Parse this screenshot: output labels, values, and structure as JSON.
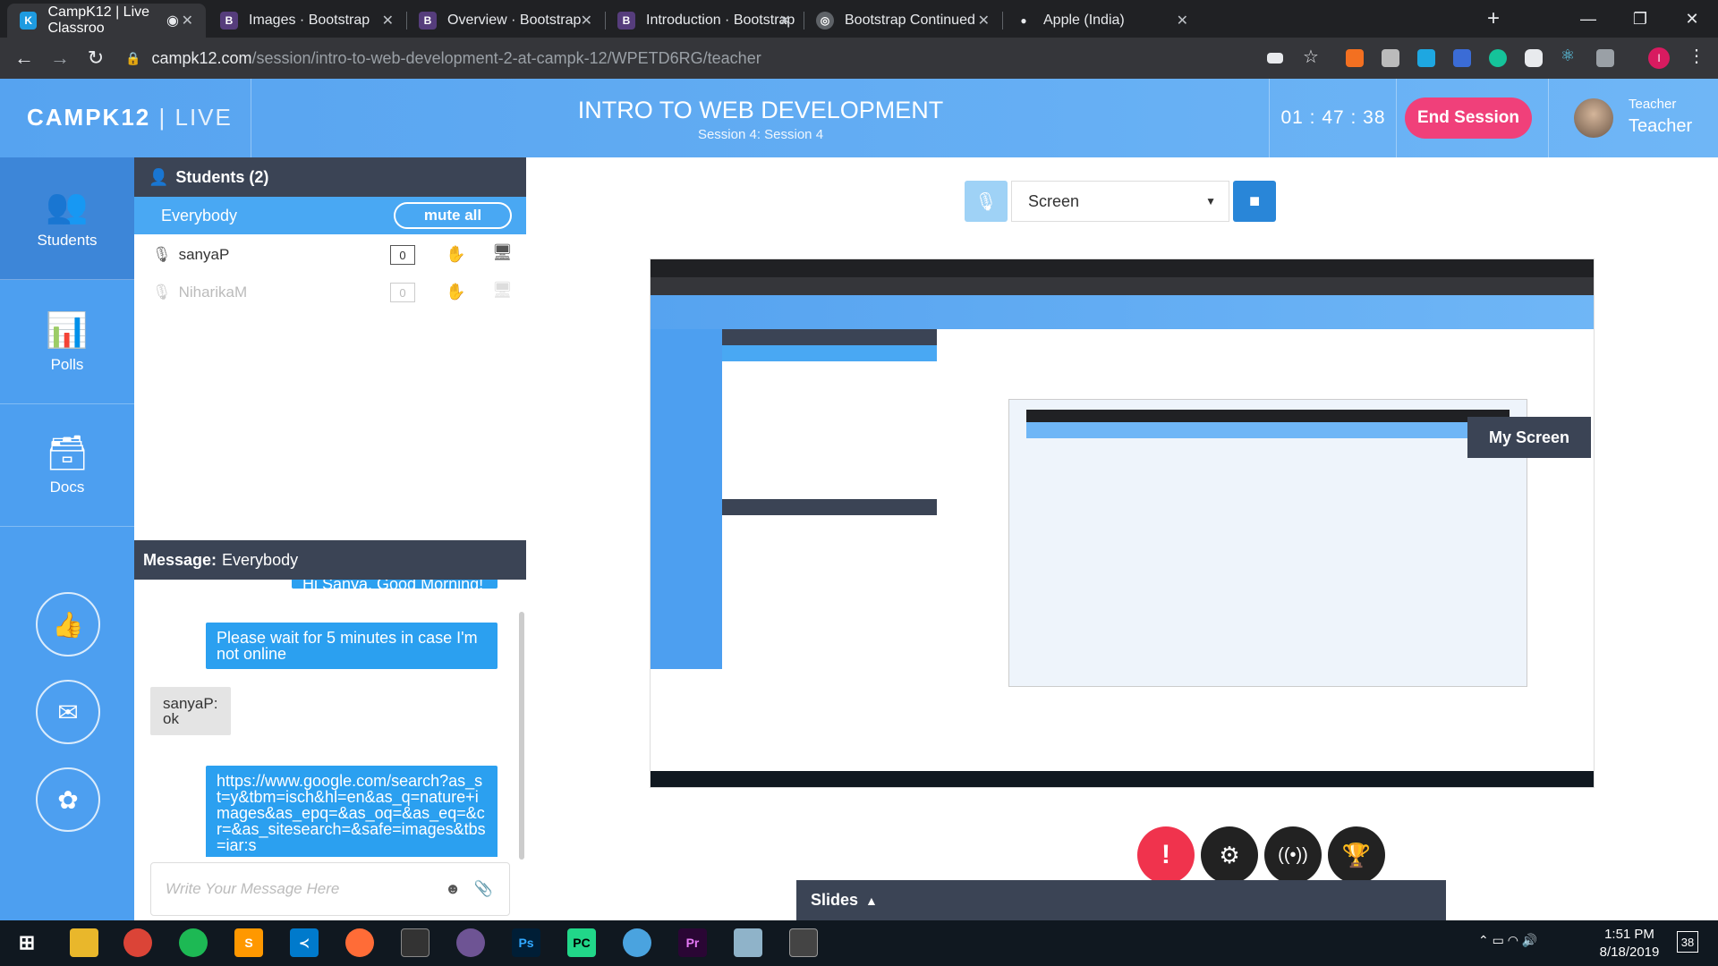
{
  "browser": {
    "tabs": [
      {
        "title": "CampK12 | Live Classroo",
        "icon": "campk12-icon",
        "active": true
      },
      {
        "title": "Images · Bootstrap",
        "icon": "bootstrap-icon"
      },
      {
        "title": "Overview · Bootstrap",
        "icon": "bootstrap-icon"
      },
      {
        "title": "Introduction · Bootstrap",
        "icon": "bootstrap-icon"
      },
      {
        "title": "Bootstrap Continued",
        "icon": "globe-icon"
      },
      {
        "title": "Apple (India)",
        "icon": "apple-icon"
      }
    ],
    "url_domain": "campk12.com",
    "url_path": "/session/intro-to-web-development-2-at-campk-12/WPETD6RG/teacher",
    "profile_initial": "I"
  },
  "app": {
    "logo_brand": "CAMPK12",
    "logo_live": "LIVE",
    "course_title": "INTRO TO WEB DEVELOPMENT",
    "session_label": "Session 4: Session 4",
    "timer": "01 : 47 : 38",
    "end_session": "End Session",
    "user_role": "Teacher",
    "user_name": "Teacher",
    "accent_color": "#56a3f0",
    "end_color": "#f0407a"
  },
  "leftnav": {
    "items": [
      {
        "label": "Students",
        "icon": "students-icon"
      },
      {
        "label": "Polls",
        "icon": "polls-icon"
      },
      {
        "label": "Docs",
        "icon": "docs-icon"
      }
    ],
    "circle_buttons": [
      "thumbs-icon",
      "feedback-icon",
      "brain-icon"
    ]
  },
  "students": {
    "header": "Students (2)",
    "everybody": "Everybody",
    "mute_all": "mute all",
    "list": [
      {
        "name": "sanyaP",
        "count": "0",
        "online": true
      },
      {
        "name": "NiharikaM",
        "count": "0",
        "online": false
      }
    ]
  },
  "messages": {
    "header_prefix": "Message:",
    "header_target": "Everybody",
    "partial_top": "Hi Sanya, Good Morning!",
    "items": [
      {
        "from": "teacher",
        "text": "Please wait for 5 minutes in case I'm not online"
      },
      {
        "from": "sanyaP:",
        "text": "ok"
      },
      {
        "from": "teacher",
        "text": "https://www.google.com/search?as_st=y&tbm=isch&hl=en&as_q=nature+images&as_epq=&as_oq=&as_eq=&cr=&as_sitesearch=&safe=images&tbs=iar:s"
      }
    ],
    "placeholder": "Write Your Message Here"
  },
  "main": {
    "screen_select": "Screen",
    "my_screen": "My Screen",
    "slides": "Slides",
    "actions": [
      "alert-icon",
      "settings-icon",
      "broadcast-icon",
      "trophy-icon"
    ]
  },
  "taskbar": {
    "apps": [
      "file-explorer-icon",
      "chrome-icon",
      "spotify-icon",
      "sublime-icon",
      "vscode-icon",
      "postman-icon",
      "terminal-icon",
      "github-icon",
      "photoshop-icon",
      "pycharm-icon",
      "network-icon",
      "premiere-icon",
      "notepad-icon",
      "photos-icon"
    ],
    "time": "1:51 PM",
    "date": "8/18/2019",
    "notifications": "38"
  }
}
